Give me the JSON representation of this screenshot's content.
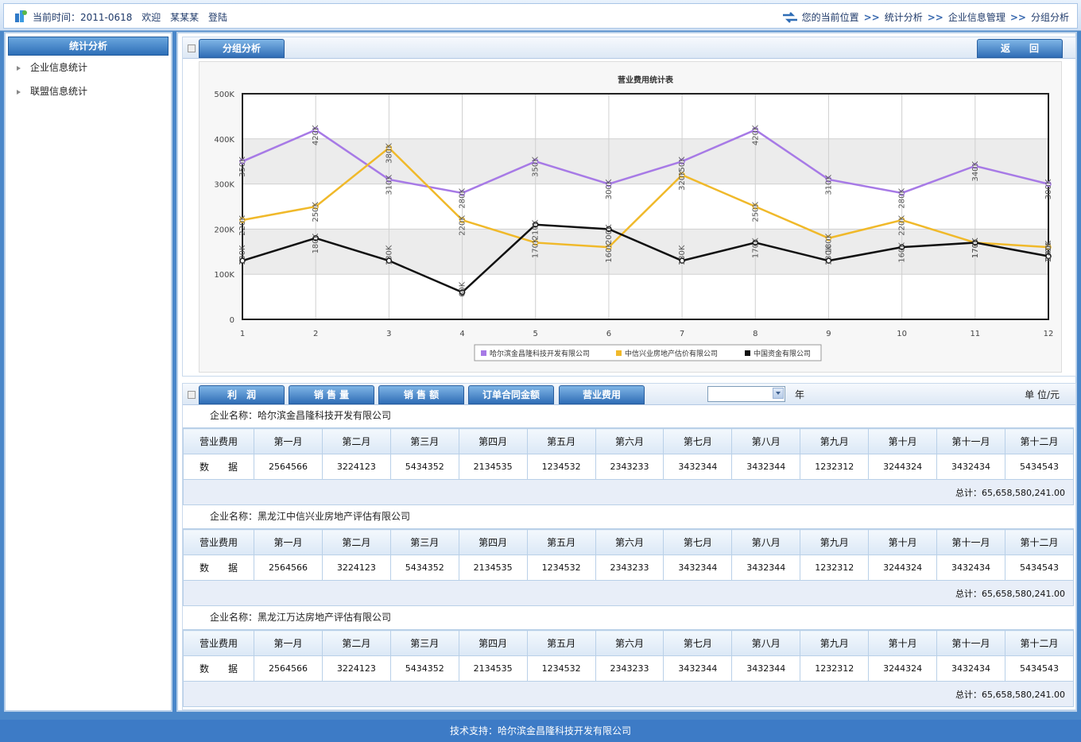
{
  "header": {
    "time_label": "当前时间：2011-0618",
    "welcome": "欢迎",
    "username": "某某某",
    "login": "登陆",
    "location_label": "您的当前位置",
    "crumbs": [
      "统计分析",
      "企业信息管理",
      "分组分析"
    ]
  },
  "sidebar": {
    "title": "统计分析",
    "items": [
      {
        "label": "企业信息统计"
      },
      {
        "label": "联盟信息统计"
      }
    ]
  },
  "top_panel": {
    "tab_label": "分组分析",
    "back_label": "返　　回"
  },
  "chart_data": {
    "type": "line",
    "title": "营业费用统计表",
    "x": [
      "1",
      "2",
      "3",
      "4",
      "5",
      "6",
      "7",
      "8",
      "9",
      "10",
      "11",
      "12"
    ],
    "yticks": [
      "0",
      "100K",
      "200K",
      "300K",
      "400K",
      "500K"
    ],
    "ylim": [
      0,
      500000
    ],
    "grid": true,
    "legend_position": "bottom",
    "series": [
      {
        "name": "哈尔滨金昌隆科技开发有限公司",
        "color": "#a77ae6",
        "values": [
          350000,
          420000,
          310000,
          280000,
          350000,
          300000,
          350000,
          420000,
          310000,
          280000,
          340000,
          300000
        ],
        "labels": [
          "350K",
          "420K",
          "310K",
          "280K",
          "350K",
          "300K",
          "350K",
          "420K",
          "310K",
          "280K",
          "340K",
          "300K"
        ]
      },
      {
        "name": "中信兴业房地产估价有限公司",
        "color": "#f0b92a",
        "values": [
          220000,
          250000,
          380000,
          220000,
          170000,
          160000,
          320000,
          250000,
          180000,
          220000,
          170000,
          160000
        ],
        "labels": [
          "220K",
          "250K",
          "380K",
          "220K",
          "170K",
          "160K",
          "320K",
          "250K",
          "180K",
          "220K",
          "170K",
          "160K"
        ]
      },
      {
        "name": "中国资金有限公司",
        "color": "#111111",
        "values": [
          130000,
          180000,
          130000,
          60000,
          210000,
          200000,
          130000,
          170000,
          130000,
          160000,
          170000,
          140000
        ],
        "labels": [
          "130K",
          "180K",
          "130K",
          "60K",
          "210K",
          "200K",
          "130K",
          "170K",
          "130K",
          "160K",
          "170K",
          "140K"
        ]
      }
    ]
  },
  "bottom_panel": {
    "tabs": [
      "利　润",
      "销 售 量",
      "销 售 额",
      "订单合同金额",
      "营业费用"
    ],
    "year_label": "年",
    "unit_label": "单 位/元",
    "months": [
      "营业费用",
      "第一月",
      "第二月",
      "第三月",
      "第四月",
      "第五月",
      "第六月",
      "第七月",
      "第八月",
      "第九月",
      "第十月",
      "第十一月",
      "第十二月"
    ],
    "row_label": "数　　据",
    "companies": [
      {
        "name": "企业名称：哈尔滨金昌隆科技开发有限公司",
        "values": [
          "2564566",
          "3224123",
          "5434352",
          "2134535",
          "1234532",
          "2343233",
          "3432344",
          "3432344",
          "1232312",
          "3244324",
          "3432434",
          "5434543"
        ],
        "total": "总计：65,658,580,241.00"
      },
      {
        "name": "企业名称：黑龙江中信兴业房地产评估有限公司",
        "values": [
          "2564566",
          "3224123",
          "5434352",
          "2134535",
          "1234532",
          "2343233",
          "3432344",
          "3432344",
          "1232312",
          "3244324",
          "3432434",
          "5434543"
        ],
        "total": "总计：65,658,580,241.00"
      },
      {
        "name": "企业名称：黑龙江万达房地产评估有限公司",
        "values": [
          "2564566",
          "3224123",
          "5434352",
          "2134535",
          "1234532",
          "2343233",
          "3432344",
          "3432344",
          "1232312",
          "3244324",
          "3432434",
          "5434543"
        ],
        "total": "总计：65,658,580,241.00"
      }
    ]
  },
  "footer": {
    "text": "技术支持：哈尔滨金昌隆科技开发有限公司"
  }
}
